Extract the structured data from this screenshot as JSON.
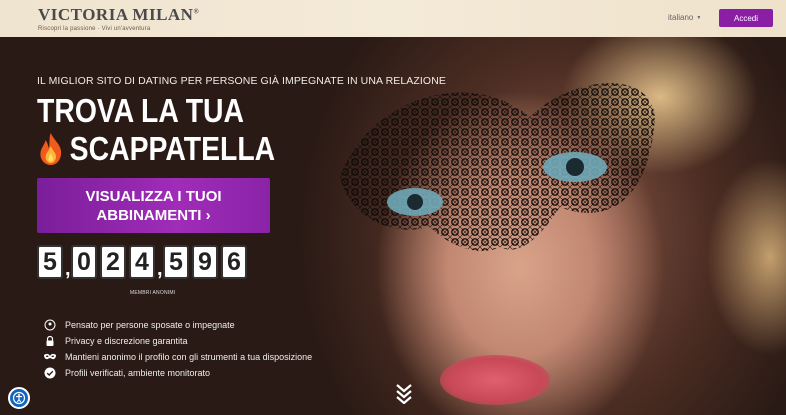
{
  "header": {
    "logo": {
      "brand": "VICTORIA MILAN",
      "registered": "®",
      "tagline": "Riscopri la passione · Vivi un'avventura"
    },
    "language": "italiano",
    "login_label": "Accedi"
  },
  "hero": {
    "eyebrow": "IL MIGLIOR SITO DI DATING PER PERSONE GIÀ IMPEGNATE IN UNA RELAZIONE",
    "headline_line1": "TROVA LA TUA",
    "headline_line2": "SCAPPATELLA",
    "cta_line1": "VISUALIZZA I TUOI",
    "cta_line2": "ABBINAMENTI ›",
    "counter_digits": [
      "5",
      "0",
      "2",
      "4",
      "5",
      "9",
      "6"
    ],
    "counter_separator": ",",
    "counter_label": "MEMBRI ANONIMI",
    "features": [
      {
        "icon": "location-pin-icon",
        "text": "Pensato per persone sposate o impegnate"
      },
      {
        "icon": "padlock-icon",
        "text": "Privacy e discrezione garantita"
      },
      {
        "icon": "mask-icon",
        "text": "Mantieni anonimo il profilo con gli strumenti a tua disposizione"
      },
      {
        "icon": "verified-check-icon",
        "text": "Profili verificati, ambiente monitorato"
      }
    ]
  },
  "colors": {
    "accent": "#8a1fa5",
    "topbar": "#f1e6d2",
    "accessibility": "#1565c0"
  }
}
